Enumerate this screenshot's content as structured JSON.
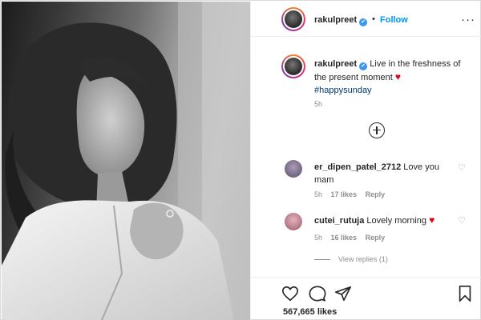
{
  "post": {
    "username": "rakulpreet",
    "verified_mark": "✔",
    "separator": "•",
    "follow_label": "Follow",
    "more_label": "···",
    "caption_text": "Live in the freshness of the present moment",
    "caption_emoji": "♥",
    "hashtag": "#happysunday",
    "time": "5h",
    "likes": "567,665 likes"
  },
  "comments": [
    {
      "username": "er_dipen_patel_2712",
      "text": "Love you mam",
      "time": "5h",
      "likes": "17 likes",
      "reply": "Reply",
      "avatar_color": "#7a6e8a"
    },
    {
      "username": "cutei_rutuja",
      "text": "Lovely morning",
      "emoji": "♥",
      "time": "5h",
      "likes": "16 likes",
      "reply": "Reply",
      "avatar_color": "#c9828f"
    }
  ],
  "view_replies": "View replies (1)",
  "icons": {
    "like": "heart-outline-icon",
    "comment": "comment-bubble-icon",
    "share": "paper-plane-icon",
    "save": "bookmark-icon",
    "add_comment": "add-circle-icon"
  },
  "colors": {
    "accent": "#0095f6",
    "heart": "#e0001b",
    "muted": "#8e8e8e",
    "verified": "#3897f0"
  }
}
